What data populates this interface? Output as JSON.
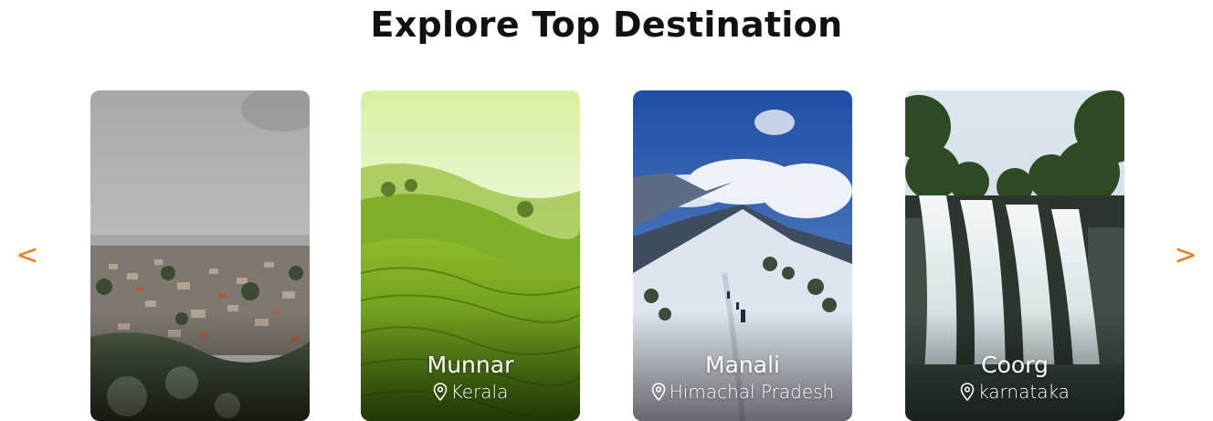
{
  "section": {
    "title": "Explore Top Destination"
  },
  "carousel": {
    "prev_icon": "chevron-left-icon",
    "next_icon": "chevron-right-icon",
    "prev_glyph": "<",
    "next_glyph": ">",
    "accent_color": "#ef7c1e",
    "cards": [
      {
        "name": "",
        "location": "",
        "scene": "hill-town-photo"
      },
      {
        "name": "Munnar",
        "location": "Kerala",
        "scene": "tea-plantation-photo"
      },
      {
        "name": "Manali",
        "location": "Himachal Pradesh",
        "scene": "snow-mountain-photo"
      },
      {
        "name": "Coorg",
        "location": "karnataka",
        "scene": "waterfall-photo"
      }
    ]
  }
}
